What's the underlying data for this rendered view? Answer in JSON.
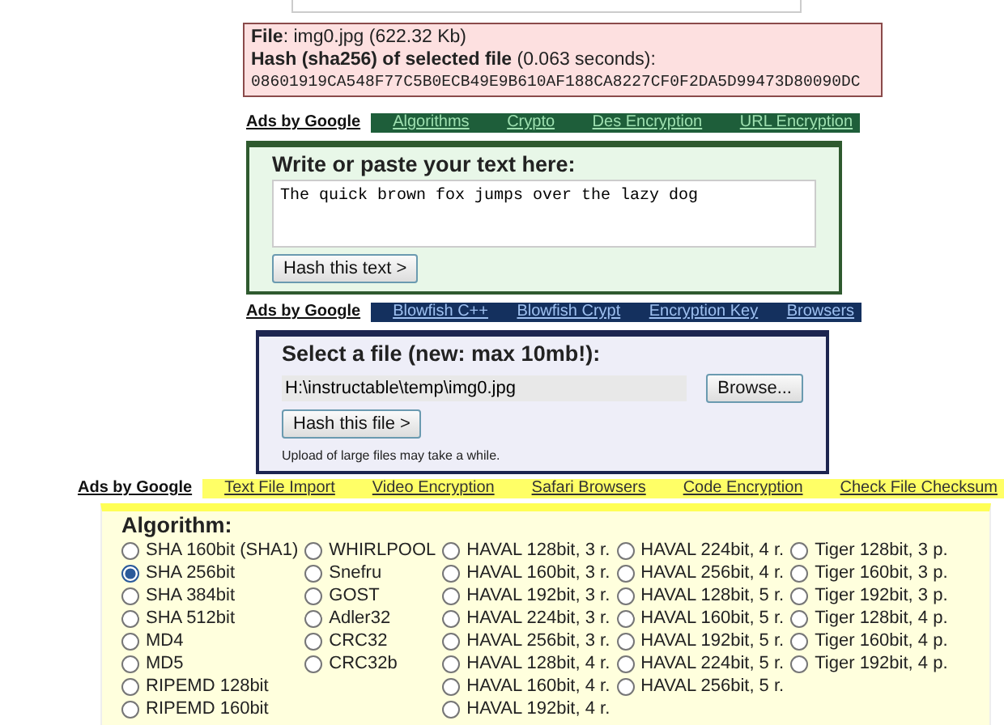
{
  "file_info": {
    "file_line": "**File**: img0.jpg (622.32 Kb)",
    "hash_line": "**Hash (sha256) of selected file** (0.063 seconds):",
    "hash": "08601919CA548F77C5B0ECB49E9B610AF188CA8227CF0F2DA5D99473D80090DC"
  },
  "ad_bars": [
    {
      "label": "Ads by Google",
      "color": "#1e5e3a",
      "links": [
        "Algorithms",
        "Crypto",
        "Des Encryption",
        "URL Encryption"
      ]
    },
    {
      "label": "Ads by Google",
      "color": "#14305e",
      "links": [
        "Blowfish C++",
        "Blowfish Crypt",
        "Encryption Key",
        "Browsers"
      ]
    },
    {
      "label": "Ads by Google",
      "color": "#ffff66",
      "links": [
        "Text File Import",
        "Video Encryption",
        "Safari Browsers",
        "Code Encryption",
        "Check File Checksum"
      ]
    }
  ],
  "text_panel": {
    "title": "Write or paste your text here:",
    "value": "The quick brown fox jumps over the lazy dog",
    "button": "Hash this text >"
  },
  "file_panel": {
    "title": "Select a file (new: max 10mb!):",
    "path": "H:\\instructable\\temp\\img0.jpg",
    "browse": "Browse...",
    "button": "Hash this file >",
    "note": "Upload of large files may take a while."
  },
  "algorithm": {
    "title": "Algorithm:",
    "columns": [
      [
        {
          "label": "SHA 160bit (SHA1)",
          "selected": false
        },
        {
          "label": "SHA 256bit",
          "selected": true
        },
        {
          "label": "SHA 384bit",
          "selected": false
        },
        {
          "label": "SHA 512bit",
          "selected": false
        },
        {
          "label": "MD4",
          "selected": false
        },
        {
          "label": "MD5",
          "selected": false
        },
        {
          "label": "RIPEMD 128bit",
          "selected": false
        },
        {
          "label": "RIPEMD 160bit",
          "selected": false
        }
      ],
      [
        {
          "label": "WHIRLPOOL",
          "selected": false
        },
        {
          "label": "Snefru",
          "selected": false
        },
        {
          "label": "GOST",
          "selected": false
        },
        {
          "label": "Adler32",
          "selected": false
        },
        {
          "label": "CRC32",
          "selected": false
        },
        {
          "label": "CRC32b",
          "selected": false
        }
      ],
      [
        {
          "label": "HAVAL 128bit, 3 r.",
          "selected": false
        },
        {
          "label": "HAVAL 160bit, 3 r.",
          "selected": false
        },
        {
          "label": "HAVAL 192bit, 3 r.",
          "selected": false
        },
        {
          "label": "HAVAL 224bit, 3 r.",
          "selected": false
        },
        {
          "label": "HAVAL 256bit, 3 r.",
          "selected": false
        },
        {
          "label": "HAVAL 128bit, 4 r.",
          "selected": false
        },
        {
          "label": "HAVAL 160bit, 4 r.",
          "selected": false
        },
        {
          "label": "HAVAL 192bit, 4 r.",
          "selected": false
        }
      ],
      [
        {
          "label": "HAVAL 224bit, 4 r.",
          "selected": false
        },
        {
          "label": "HAVAL 256bit, 4 r.",
          "selected": false
        },
        {
          "label": "HAVAL 128bit, 5 r.",
          "selected": false
        },
        {
          "label": "HAVAL 160bit, 5 r.",
          "selected": false
        },
        {
          "label": "HAVAL 192bit, 5 r.",
          "selected": false
        },
        {
          "label": "HAVAL 224bit, 5 r.",
          "selected": false
        },
        {
          "label": "HAVAL 256bit, 5 r.",
          "selected": false
        }
      ],
      [
        {
          "label": "Tiger 128bit, 3 p.",
          "selected": false
        },
        {
          "label": "Tiger 160bit, 3 p.",
          "selected": false
        },
        {
          "label": "Tiger 192bit, 3 p.",
          "selected": false
        },
        {
          "label": "Tiger 128bit, 4 p.",
          "selected": false
        },
        {
          "label": "Tiger 160bit, 4 p.",
          "selected": false
        },
        {
          "label": "Tiger 192bit, 4 p.",
          "selected": false
        }
      ]
    ]
  }
}
